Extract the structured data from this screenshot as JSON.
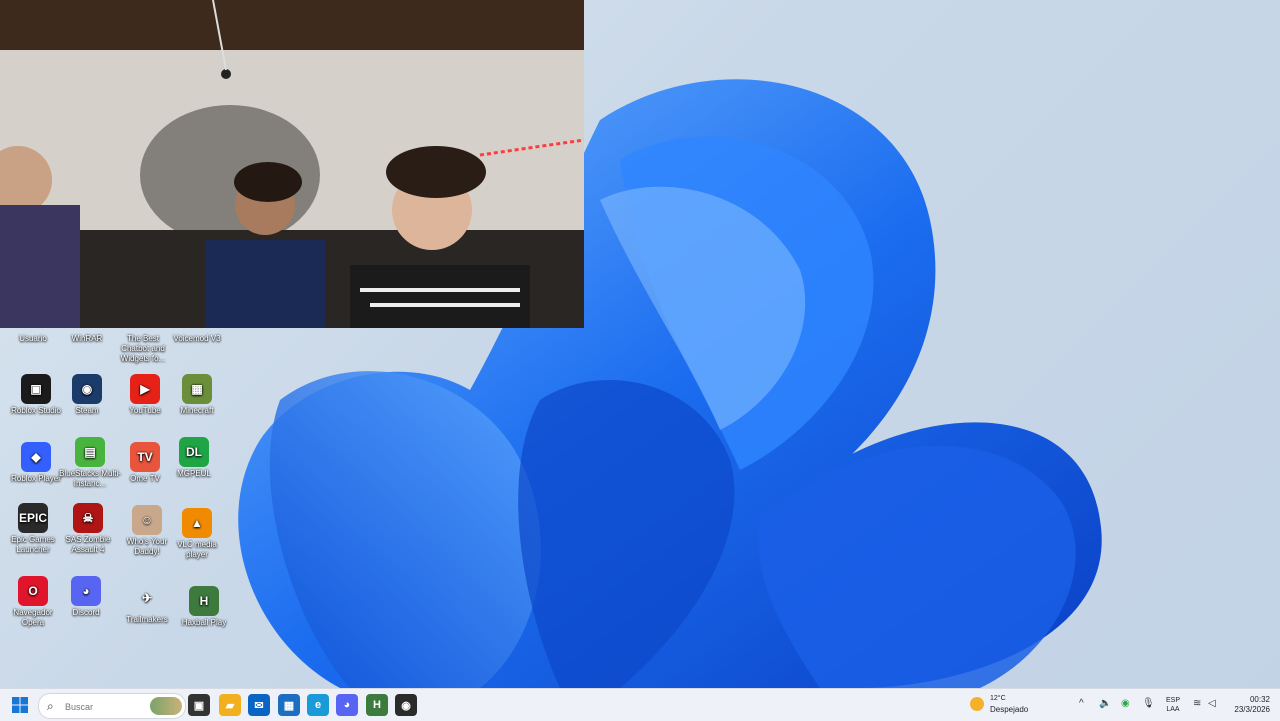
{
  "desktop_icons": [
    {
      "label": "Usuario",
      "name": "usuario",
      "glyph": "",
      "color": "#00000000"
    },
    {
      "label": "WinRAR",
      "name": "winrar",
      "glyph": "",
      "color": "#00000000"
    },
    {
      "label": "The Best Chatbot and Widgets fo...",
      "name": "chatbot-widgets",
      "glyph": "",
      "color": "#00000000"
    },
    {
      "label": "Voicemod V3",
      "name": "voicemod",
      "glyph": "",
      "color": "#00000000"
    },
    {
      "label": "Roblox Studio",
      "name": "roblox-studio",
      "glyph": "▣",
      "color": "#1b1b1b"
    },
    {
      "label": "Steam",
      "name": "steam",
      "glyph": "◉",
      "color": "#1b3b6b"
    },
    {
      "label": "YouTube",
      "name": "youtube",
      "glyph": "▶",
      "color": "#e62117"
    },
    {
      "label": "Minecraft",
      "name": "minecraft",
      "glyph": "▦",
      "color": "#6b8e3a"
    },
    {
      "label": "Roblox Player",
      "name": "roblox-player",
      "glyph": "◆",
      "color": "#335fff"
    },
    {
      "label": "BlueStacks Multi-Instanc...",
      "name": "bluestacks",
      "glyph": "▤",
      "color": "#48b33d"
    },
    {
      "label": "Ome TV",
      "name": "ome-tv",
      "glyph": "TV",
      "color": "#e8543c"
    },
    {
      "label": "MGPEUL",
      "name": "mgpeul",
      "glyph": "DL",
      "color": "#1fa546"
    },
    {
      "label": "Epic Games Launcher",
      "name": "epic-games",
      "glyph": "EPIC",
      "color": "#2a2a2a"
    },
    {
      "label": "SAS Zombie Assault 4",
      "name": "sas-zombie",
      "glyph": "☠",
      "color": "#b01515"
    },
    {
      "label": "Who's Your Daddy!",
      "name": "whos-your-daddy",
      "glyph": "☺",
      "color": "#c9a78a"
    },
    {
      "label": "VLC media player",
      "name": "vlc",
      "glyph": "▲",
      "color": "#f08a00"
    },
    {
      "label": "Navegador Opera",
      "name": "opera",
      "glyph": "O",
      "color": "#e0152b"
    },
    {
      "label": "Discord",
      "name": "discord",
      "glyph": "◕",
      "color": "#5865f2"
    },
    {
      "label": "Trailmakers",
      "name": "trailmakers",
      "glyph": "✈",
      "color": "#00000000"
    },
    {
      "label": "Haxball Play",
      "name": "haxball-play",
      "glyph": "H",
      "color": "#3d7a3d"
    }
  ],
  "taskbar": {
    "search_placeholder": "Buscar",
    "apps": [
      {
        "name": "task-view",
        "glyph": "▣",
        "color": "#333333"
      },
      {
        "name": "file-explorer",
        "glyph": "▰",
        "color": "#f2b01e"
      },
      {
        "name": "outlook",
        "glyph": "✉",
        "color": "#0a64c4"
      },
      {
        "name": "store",
        "glyph": "▦",
        "color": "#1b6ec2"
      },
      {
        "name": "edge",
        "glyph": "e",
        "color": "#1a9bd7"
      },
      {
        "name": "discord",
        "glyph": "◕",
        "color": "#5865f2"
      },
      {
        "name": "haxball",
        "glyph": "H",
        "color": "#3d7a3d"
      },
      {
        "name": "obs",
        "glyph": "◉",
        "color": "#2b2b2b"
      }
    ],
    "weather": {
      "temp": "12°C",
      "condition": "Despejado"
    },
    "language": {
      "line1": "ESP",
      "line2": "LAA"
    },
    "clock": {
      "time": "00:32",
      "date": "23/3/2026"
    }
  }
}
